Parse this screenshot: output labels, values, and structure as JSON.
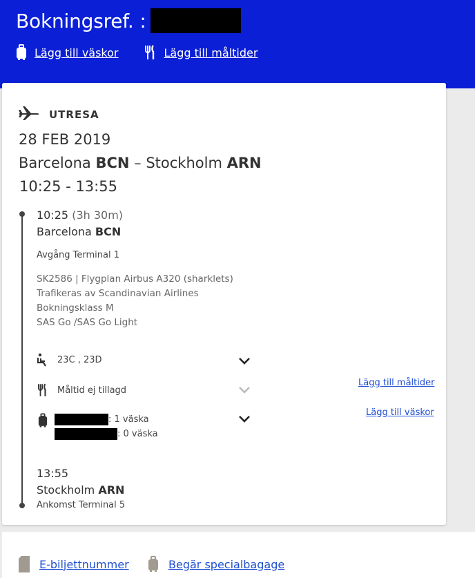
{
  "header": {
    "title": "Bokningsref. :",
    "links": {
      "add_bags": "Lägg till väskor",
      "add_meals": "Lägg till måltider"
    }
  },
  "segment": {
    "label": "UTRESA",
    "date": "28 FEB 2019",
    "origin_city": "Barcelona",
    "origin_code": "BCN",
    "separator": "–",
    "dest_city": "Stockholm",
    "dest_code": "ARN",
    "times": "10:25 - 13:55",
    "departure": {
      "time": "10:25",
      "duration": "(3h 30m)",
      "city": "Barcelona",
      "code": "BCN",
      "terminal": "Avgång Terminal 1"
    },
    "flight": {
      "number_and_aircraft": "SK2586 | Flygplan Airbus A320 (sharklets)",
      "operator": "Trafikeras av Scandinavian Airlines",
      "booking_class": "Bokningsklass M",
      "fare": "SAS Go /SAS Go Light"
    },
    "seats": "23C , 23D",
    "meal": {
      "status": "Måltid ej tillagd",
      "link": "Lägg till måltider"
    },
    "baggage": {
      "line1": ": 1 väska",
      "line2": ": 0 väska",
      "link": "Lägg till väskor"
    },
    "arrival": {
      "time": "13:55",
      "city": "Stockholm",
      "code": "ARN",
      "terminal": "Ankomst Terminal 5"
    }
  },
  "footer": {
    "eticket": "E-biljettnummer",
    "special_baggage": "Begär specialbagage"
  },
  "colors": {
    "header_bg": "#0a1fd6",
    "link_blue": "#1f4fd1",
    "text": "#333333"
  }
}
